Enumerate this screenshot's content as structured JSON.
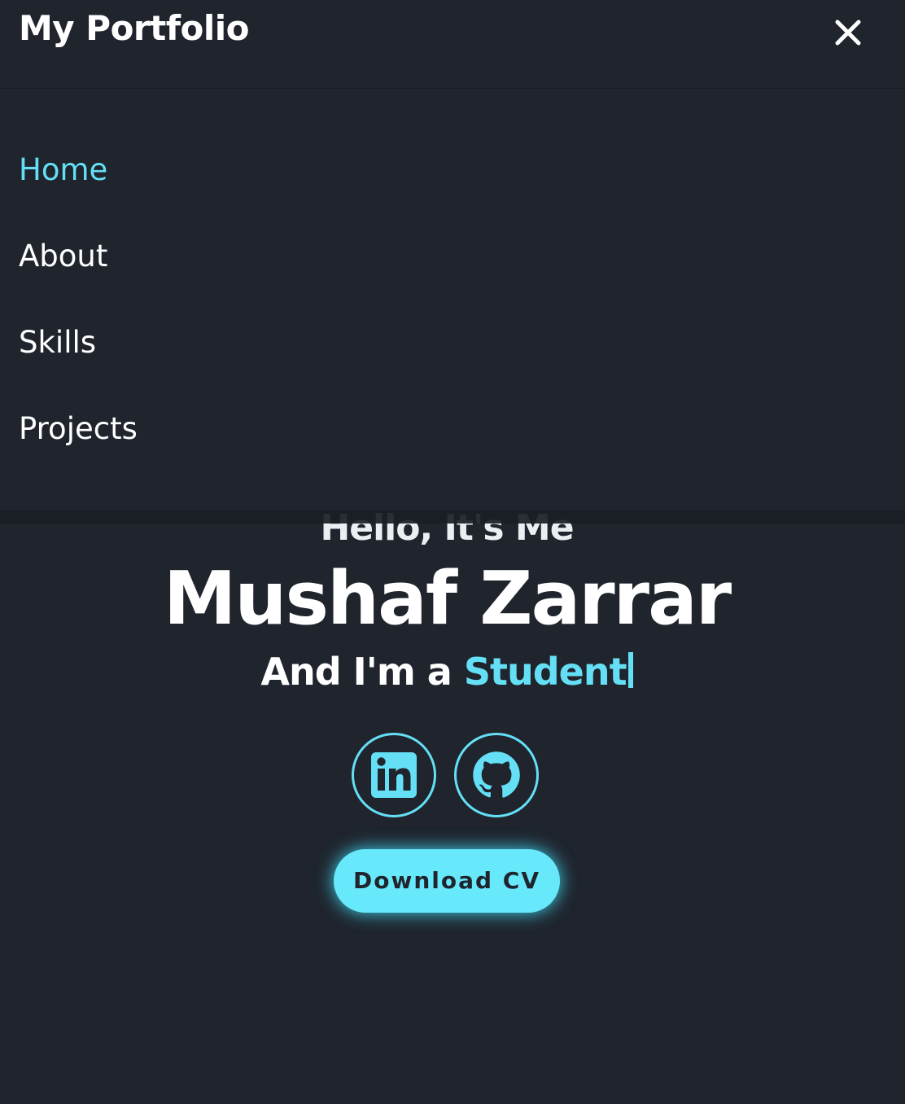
{
  "header": {
    "logo": "My Portfolio",
    "close_icon": "close-icon"
  },
  "nav": {
    "items": [
      {
        "label": "Home",
        "active": true
      },
      {
        "label": "About",
        "active": false
      },
      {
        "label": "Skills",
        "active": false
      },
      {
        "label": "Projects",
        "active": false
      }
    ]
  },
  "hero": {
    "greeting": "Hello, It's Me",
    "name": "Mushaf Zarrar",
    "role_prefix": "And I'm a",
    "role_highlight": "Student"
  },
  "social": {
    "linkedin_icon": "linkedin-icon",
    "github_icon": "github-icon"
  },
  "cta": {
    "download_label": "Download CV"
  },
  "colors": {
    "background": "#1f242d",
    "accent": "#65dff5",
    "text": "#ffffff"
  }
}
